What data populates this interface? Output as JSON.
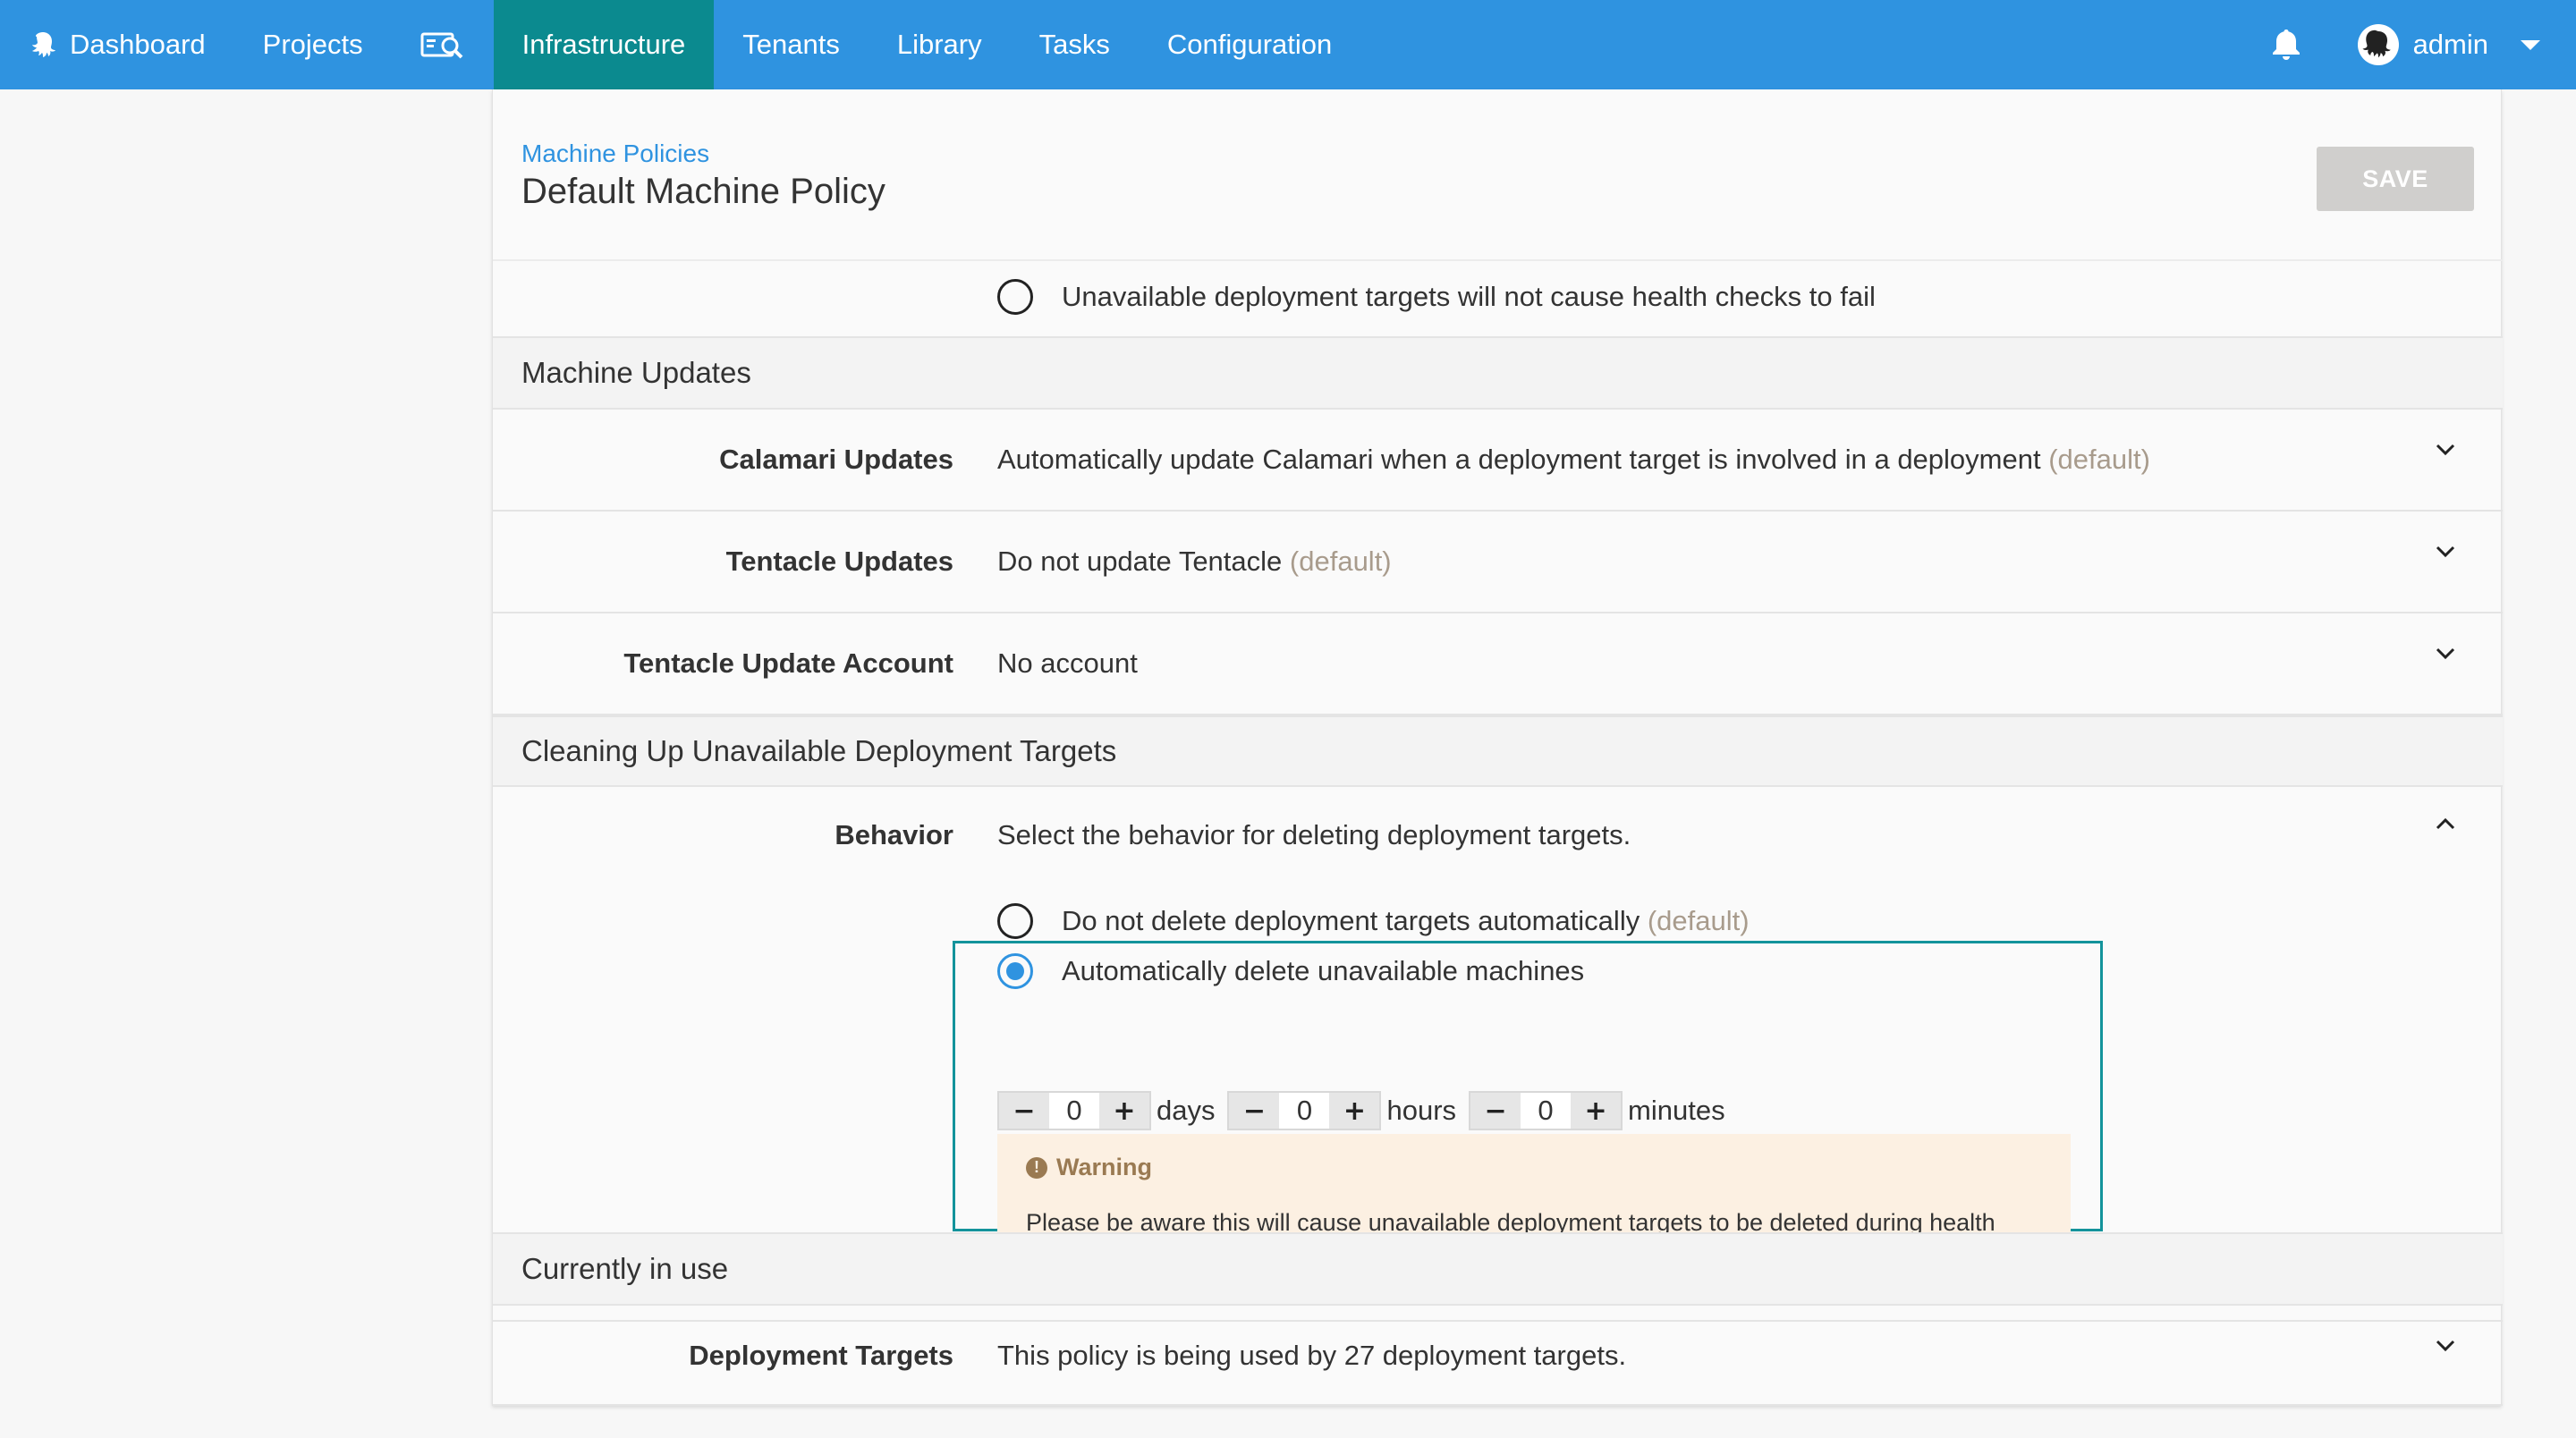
{
  "nav": {
    "items": [
      {
        "label": "Dashboard"
      },
      {
        "label": "Projects"
      },
      {
        "label": "Infrastructure"
      },
      {
        "label": "Tenants"
      },
      {
        "label": "Library"
      },
      {
        "label": "Tasks"
      },
      {
        "label": "Configuration"
      }
    ],
    "active": "Infrastructure",
    "user": "admin",
    "color": "#2f93e0",
    "active_color": "#0b8a8f"
  },
  "header": {
    "breadcrumb": "Machine Policies",
    "title": "Default Machine Policy",
    "save_label": "SAVE"
  },
  "health": {
    "unavailable_option": "Unavailable deployment targets will not cause health checks to fail"
  },
  "machine_updates": {
    "heading": "Machine Updates",
    "calamari_label": "Calamari Updates",
    "calamari_value": "Automatically update Calamari when a deployment target is involved in a deployment",
    "calamari_default": "(default)",
    "tentacle_label": "Tentacle Updates",
    "tentacle_value": "Do not update Tentacle",
    "tentacle_default": "(default)",
    "account_label": "Tentacle Update Account",
    "account_value": "No account"
  },
  "cleanup": {
    "heading": "Cleaning Up Unavailable Deployment Targets",
    "behavior_label": "Behavior",
    "behavior_desc": "Select the behavior for deleting deployment targets.",
    "option_no_delete": "Do not delete deployment targets automatically",
    "option_no_delete_default": "(default)",
    "option_auto_delete": "Automatically delete unavailable machines",
    "days_value": "0",
    "days_unit": "days",
    "hours_value": "0",
    "hours_unit": "hours",
    "minutes_value": "0",
    "minutes_unit": "minutes",
    "minus": "−",
    "plus": "+",
    "warning_title": "Warning",
    "warning_icon": "!",
    "warning_text": "Please be aware this will cause unavailable deployment targets to be deleted during health checks if they do not become available within this time."
  },
  "usage": {
    "heading": "Currently in use",
    "targets_label": "Deployment Targets",
    "targets_value": "This policy is being used by 27 deployment targets."
  }
}
